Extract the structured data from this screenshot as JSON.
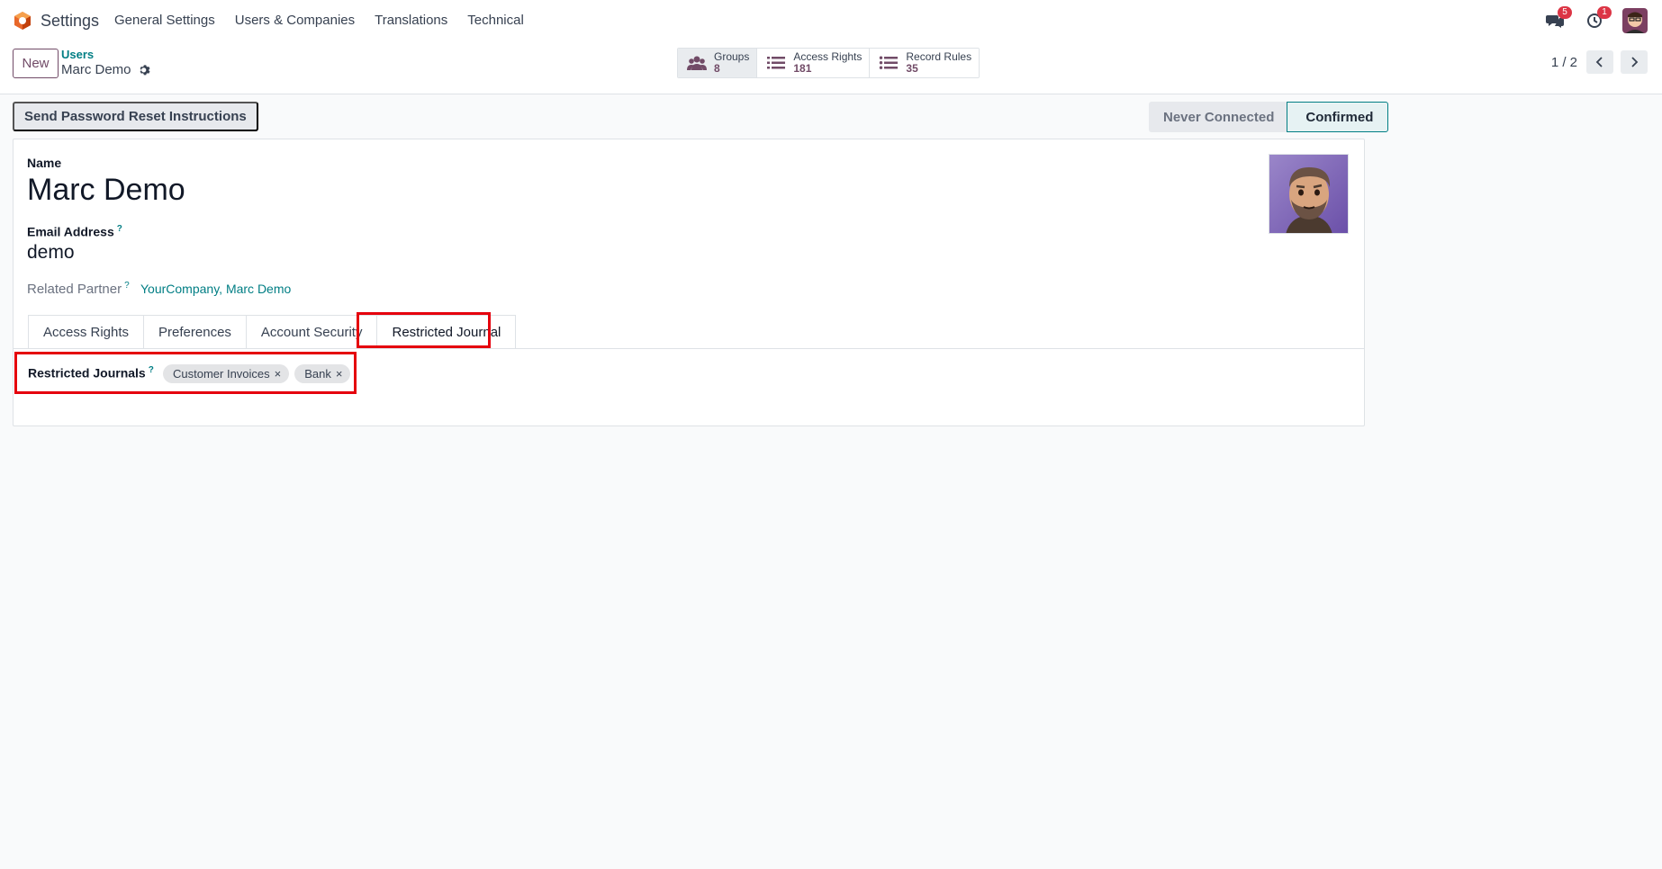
{
  "navbar": {
    "app_title": "Settings",
    "menu": [
      "General Settings",
      "Users & Companies",
      "Translations",
      "Technical"
    ],
    "messages_badge": "5",
    "activity_badge": "1"
  },
  "control_panel": {
    "new_label": "New",
    "breadcrumb_parent": "Users",
    "breadcrumb_current": "Marc Demo",
    "smart_buttons": [
      {
        "label": "Groups",
        "count": "8",
        "icon": "users-icon"
      },
      {
        "label": "Access Rights",
        "count": "181",
        "icon": "list-icon"
      },
      {
        "label": "Record Rules",
        "count": "35",
        "icon": "list-icon"
      }
    ],
    "pager_value": "1 / 2"
  },
  "header": {
    "reset_button": "Send Password Reset Instructions",
    "status_steps": [
      "Never Connected",
      "Confirmed"
    ],
    "active_status": "Confirmed"
  },
  "form": {
    "name_label": "Name",
    "name_value": "Marc Demo",
    "email_label": "Email Address",
    "email_value": "demo",
    "partner_label": "Related Partner",
    "partner_value": "YourCompany, Marc Demo",
    "help_mark": "?",
    "tabs": [
      "Access Rights",
      "Preferences",
      "Account Security",
      "Restricted Journal"
    ],
    "active_tab": "Restricted Journal",
    "restricted_journals_label": "Restricted Journals",
    "restricted_journals": [
      "Customer Invoices",
      "Bank"
    ],
    "tag_remove": "×"
  },
  "colors": {
    "brand": "#714b67",
    "accent": "#017e84",
    "highlight": "#e5000d"
  }
}
